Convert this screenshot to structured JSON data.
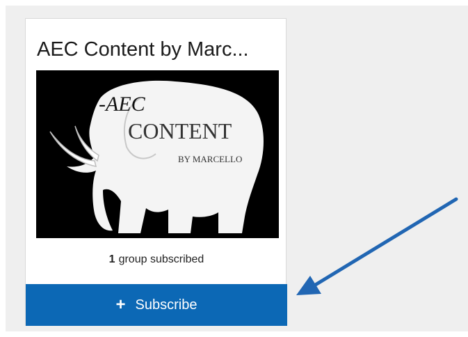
{
  "card": {
    "title": "AEC Content by Marc...",
    "subscriber_count": "1",
    "subscriber_text": "group subscribed",
    "subscribe_label": "Subscribe",
    "subscribe_icon": "plus-icon"
  },
  "thumbnail": {
    "logo_line1": "-AEC",
    "logo_line2": "CONTENT",
    "logo_line3": "BY MARCELLO"
  },
  "colors": {
    "button": "#0c68b5",
    "arrow": "#2166b3",
    "backdrop": "#efefef"
  }
}
